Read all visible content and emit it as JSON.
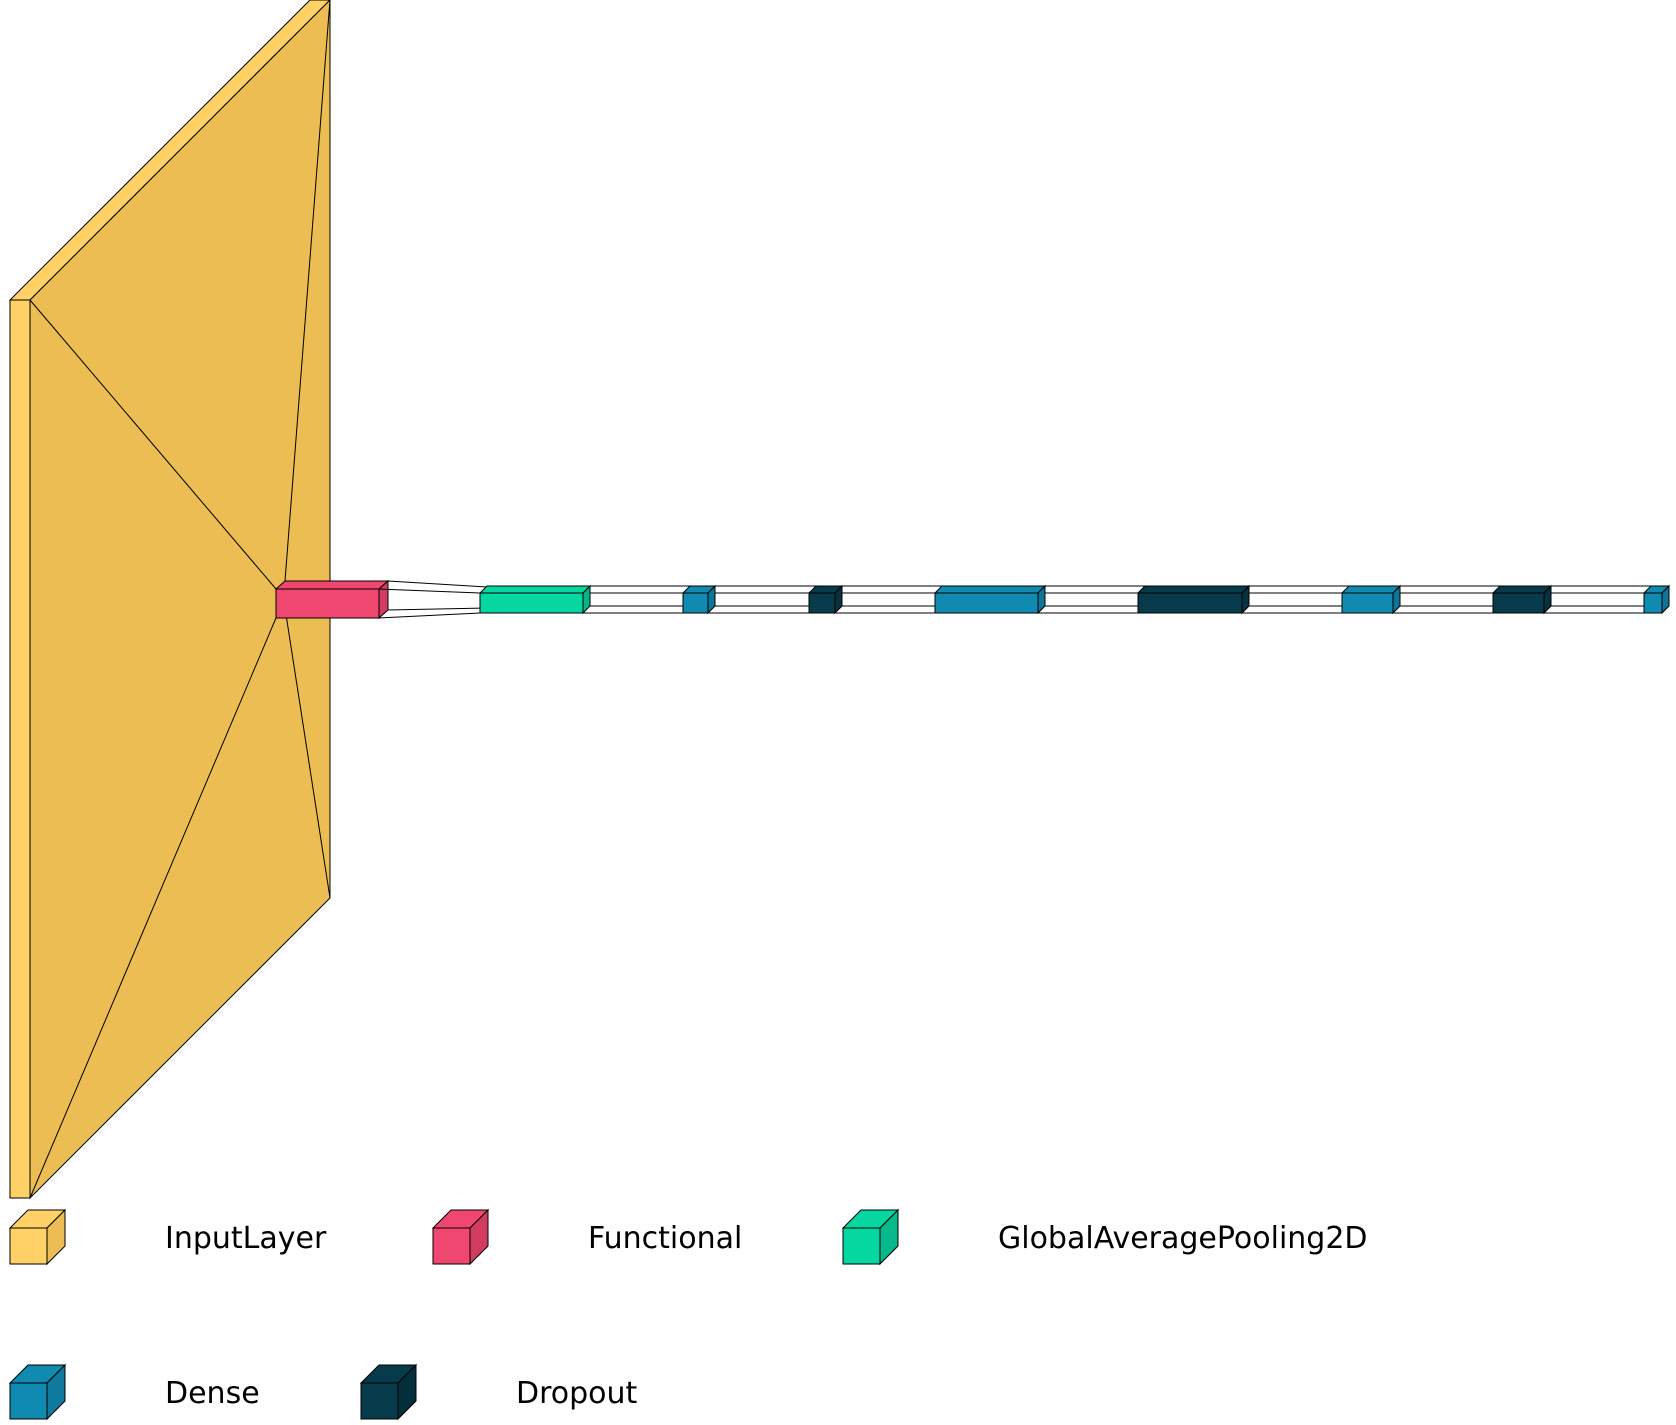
{
  "legend": {
    "items": [
      {
        "label": "InputLayer",
        "color": "#ffd166"
      },
      {
        "label": "Functional",
        "color": "#ef476f"
      },
      {
        "label": "GlobalAveragePooling2D",
        "color": "#06d6a0"
      },
      {
        "label": "Dense",
        "color": "#118ab2"
      },
      {
        "label": "Dropout",
        "color": "#073b4c"
      }
    ]
  },
  "layers": [
    {
      "type": "InputLayer",
      "color": "#ffd166"
    },
    {
      "type": "Functional",
      "color": "#ef476f"
    },
    {
      "type": "GlobalAveragePooling2D",
      "color": "#06d6a0"
    },
    {
      "type": "Dense",
      "color": "#118ab2"
    },
    {
      "type": "Dropout",
      "color": "#073b4c"
    },
    {
      "type": "Dense",
      "color": "#118ab2"
    },
    {
      "type": "Dropout",
      "color": "#073b4c"
    },
    {
      "type": "Dense",
      "color": "#118ab2"
    },
    {
      "type": "Dropout",
      "color": "#073b4c"
    },
    {
      "type": "Dense",
      "color": "#118ab2"
    }
  ]
}
